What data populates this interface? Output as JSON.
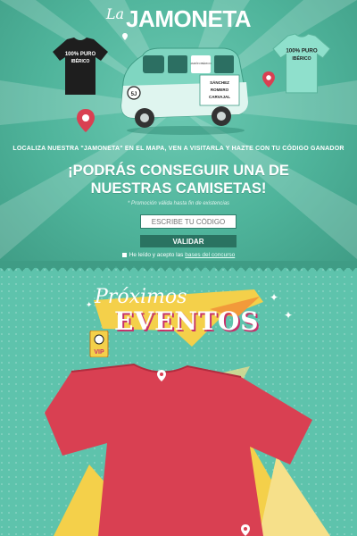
{
  "logo": {
    "prefix": "La",
    "name": "JAMONETA"
  },
  "tshirts": {
    "left_print": "100% PURO IBÉRICO",
    "right_print": "100% PURO IBÉRICO"
  },
  "van": {
    "side_text": "SÁNCHEZ ROMERO CARVAJAL",
    "window_text": "JAMÓN IBÉRICO PURO"
  },
  "promo": {
    "info": "LOCALIZA NUESTRA \"JAMONETA\" EN EL MAPA, VEN A VISITARLA Y HAZTE CON TU CÓDIGO GANADOR",
    "headline": "¡PODRÁS CONSEGUIR UNA DE NUESTRAS CAMISETAS!",
    "note": "* Promoción válida hasta fin de existencias",
    "code_placeholder": "ESCRIBE TU CÓDIGO",
    "validate_label": "VALIDAR",
    "terms_text": "He leído y acepto las ",
    "terms_link": "bases del concurso"
  },
  "events": {
    "title_script": "Próximos",
    "title_bold": "EVENTOS",
    "badge": "VIP"
  },
  "colors": {
    "teal": "#5cc0a8",
    "dark_teal": "#2a7361",
    "red": "#d94052",
    "yellow": "#f4d04a",
    "magenta": "#c6306b"
  }
}
